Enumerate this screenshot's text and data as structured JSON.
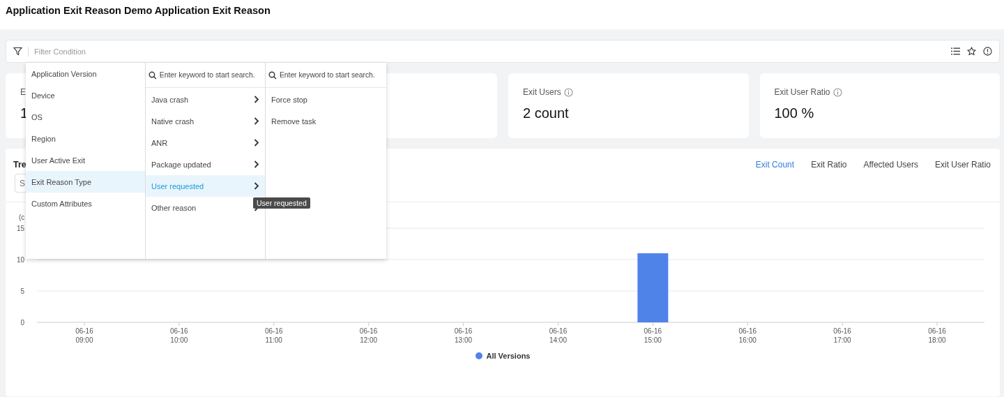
{
  "page_title": "Application Exit Reason Demo Application Exit Reason",
  "filter": {
    "placeholder": "Filter Condition"
  },
  "metric_cards": [
    {
      "kind": "metric",
      "label": "E",
      "value": "1",
      "info": false
    },
    {
      "kind": "covered"
    },
    {
      "kind": "metric",
      "label": "Exit Users",
      "value": "2 count",
      "info": true
    },
    {
      "kind": "metric",
      "label": "Exit User Ratio",
      "value": "100 %",
      "info": true
    }
  ],
  "trend": {
    "title": "Tre",
    "search_placeholder": "S",
    "tabs": [
      {
        "label": "Exit Count",
        "selected": true
      },
      {
        "label": "Exit Ratio",
        "selected": false
      },
      {
        "label": "Affected Users",
        "selected": false
      },
      {
        "label": "Exit User Ratio",
        "selected": false
      }
    ],
    "chart_data": {
      "type": "bar",
      "ylabel": "(c",
      "categories": [
        "06-16 09:00",
        "06-16 10:00",
        "06-16 11:00",
        "06-16 12:00",
        "06-16 13:00",
        "06-16 14:00",
        "06-16 15:00",
        "06-16 16:00",
        "06-16 17:00",
        "06-16 18:00"
      ],
      "ylim": [
        0,
        15
      ],
      "yticks": [
        0,
        5,
        10,
        15
      ],
      "series": [
        {
          "name": "All Versions",
          "color": "#5083e8",
          "values": [
            0,
            0,
            0,
            0,
            0,
            0,
            11,
            0,
            0,
            0
          ]
        }
      ]
    }
  },
  "dropdown": {
    "columns": [
      {
        "items": [
          {
            "label": "Application Version",
            "selected": false,
            "expandable": false
          },
          {
            "label": "Device",
            "selected": false,
            "expandable": false
          },
          {
            "label": "OS",
            "selected": false,
            "expandable": false
          },
          {
            "label": "Region",
            "selected": false,
            "expandable": false
          },
          {
            "label": "User Active Exit",
            "selected": false,
            "expandable": false
          },
          {
            "label": "Exit Reason Type",
            "selected": true,
            "expandable": false
          },
          {
            "label": "Custom Attributes",
            "selected": false,
            "expandable": false
          }
        ]
      },
      {
        "search_placeholder": "Enter keyword to start search.",
        "items": [
          {
            "label": "Java crash",
            "selected": false,
            "expandable": true
          },
          {
            "label": "Native crash",
            "selected": false,
            "expandable": true
          },
          {
            "label": "ANR",
            "selected": false,
            "expandable": true
          },
          {
            "label": "Package updated",
            "selected": false,
            "expandable": true
          },
          {
            "label": "User requested",
            "selected": true,
            "expandable": true
          },
          {
            "label": "Other reason",
            "selected": false,
            "expandable": true
          }
        ]
      },
      {
        "search_placeholder": "Enter keyword to start search.",
        "items": [
          {
            "label": "Force stop",
            "selected": false,
            "expandable": false
          },
          {
            "label": "Remove task",
            "selected": false,
            "expandable": false
          }
        ]
      }
    ],
    "tooltip": "User requested"
  }
}
